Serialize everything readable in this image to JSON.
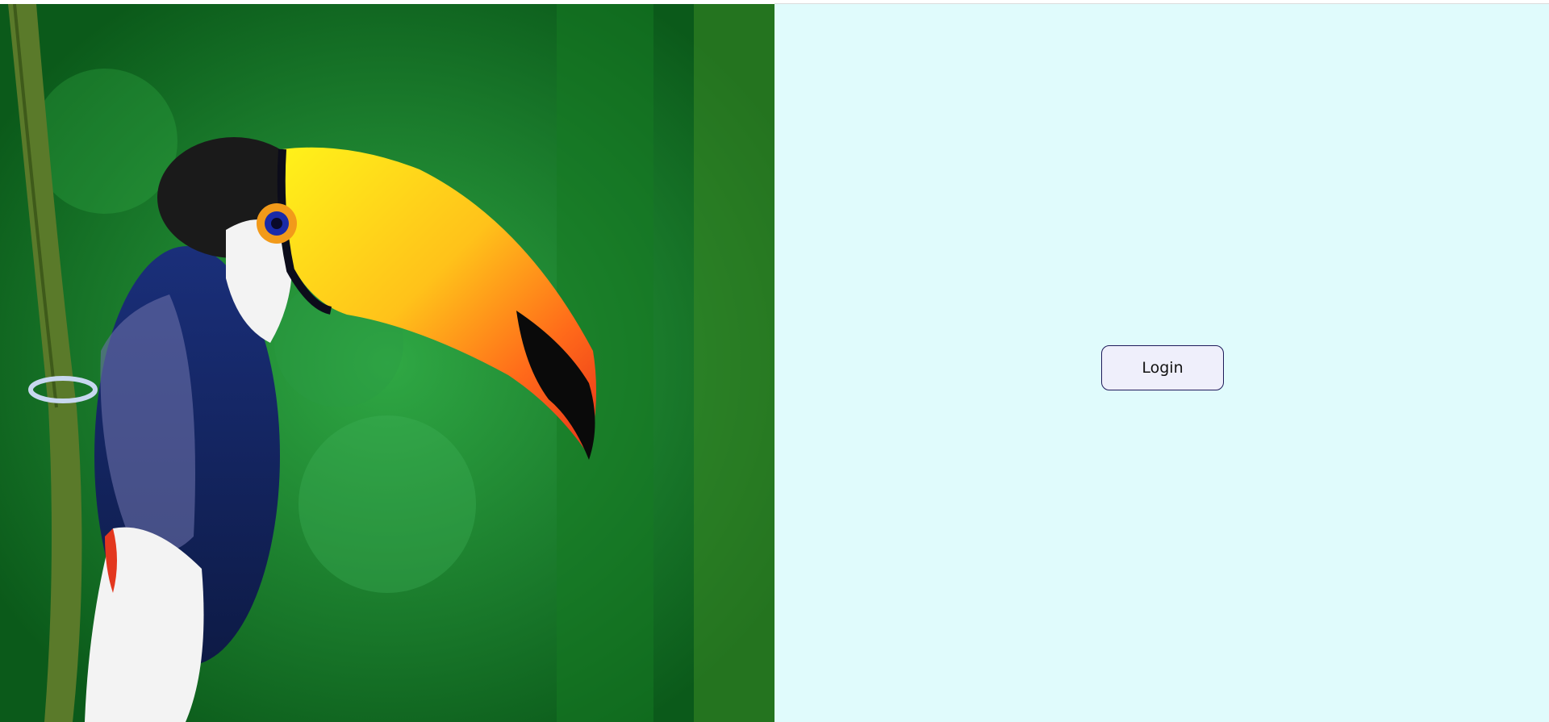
{
  "hero": {
    "image_subject": "toucan-photo",
    "colors": {
      "background_green": "#1e8f2a",
      "beak_yellow": "#f5e21a",
      "beak_orange": "#ff5a1e",
      "plumage_blue": "#1b2f6e",
      "bib_white": "#f3f3f3",
      "eye_ring": "#1a2aa8"
    }
  },
  "panel": {
    "background": "#e0fbfc",
    "login_label": "Login"
  }
}
